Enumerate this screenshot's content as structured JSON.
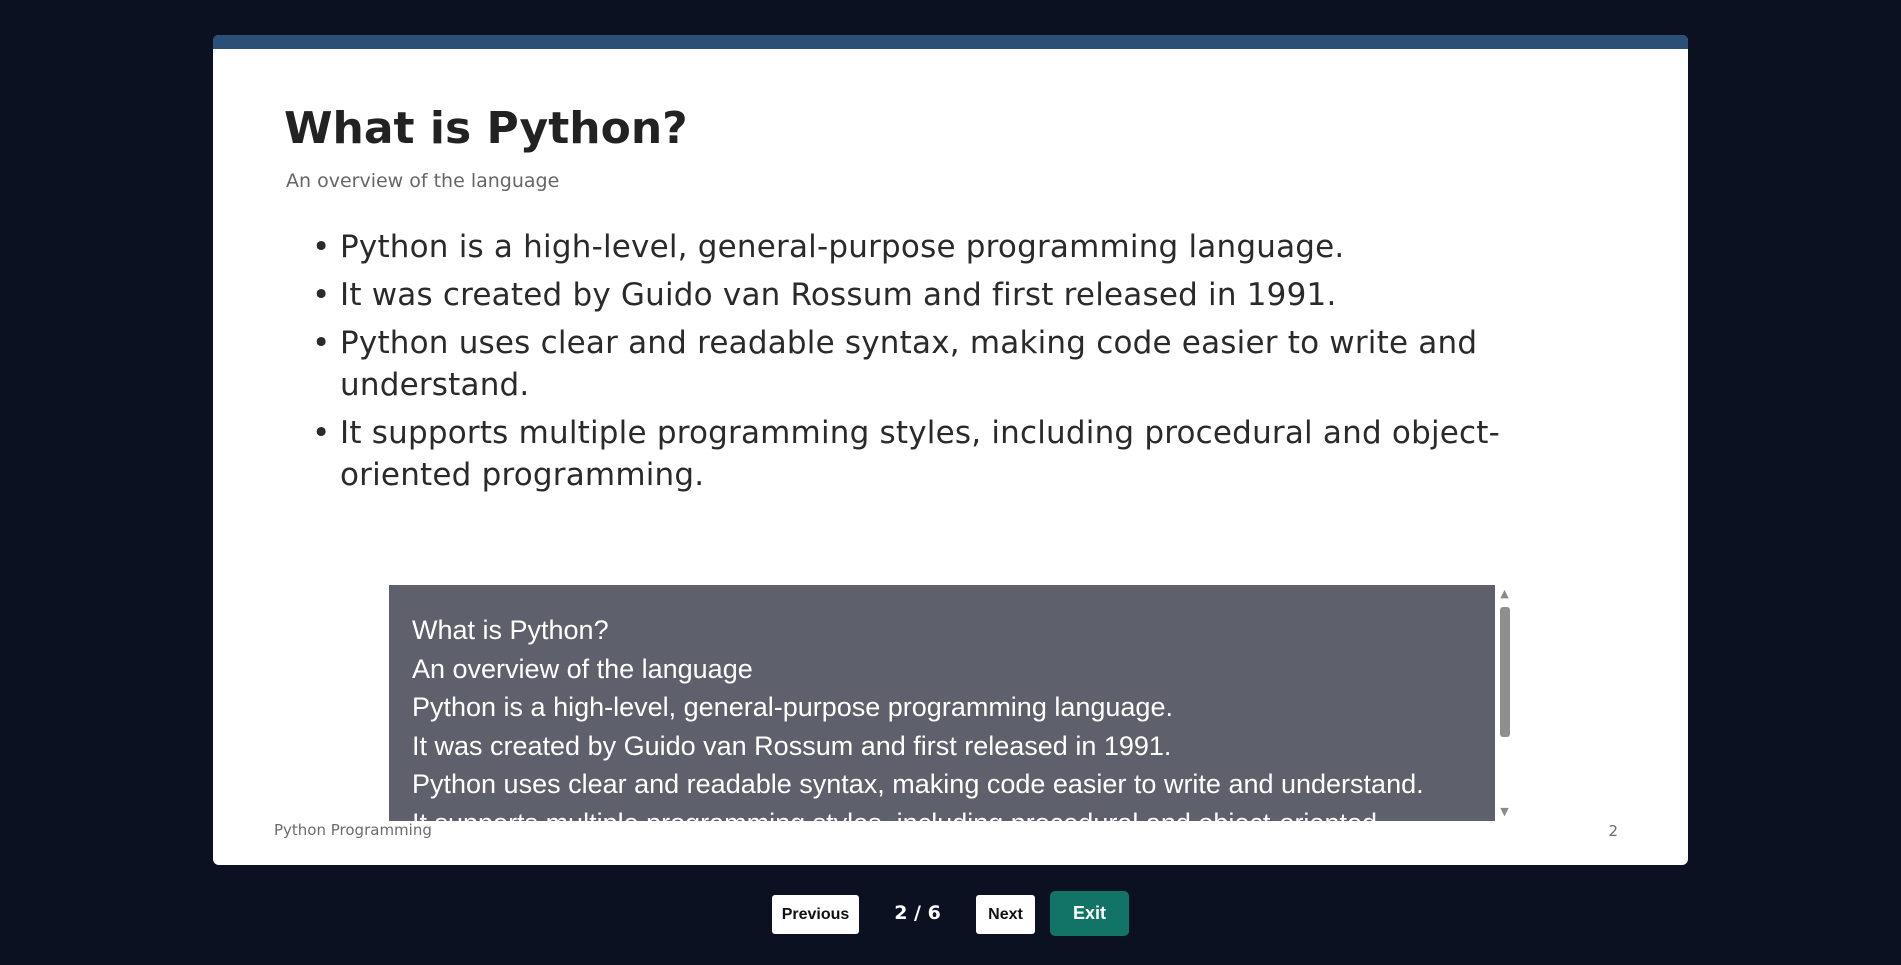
{
  "slide": {
    "title": "What is Python?",
    "subtitle": "An overview of the language",
    "bullets": [
      "Python is a high-level, general-purpose programming language.",
      "It was created by Guido van Rossum and first released in 1991.",
      "Python uses clear and readable syntax, making code easier to write and understand.",
      "It supports multiple programming styles, including procedural and object-oriented programming."
    ],
    "footer_left": "Python Programming",
    "footer_right": "2"
  },
  "captions": {
    "lines": [
      "What is Python?",
      "An overview of the language",
      "Python is a high-level, general-purpose programming language.",
      "It was created by Guido van Rossum and first released in 1991.",
      "Python uses clear and readable syntax, making code easier to write and understand.",
      "It supports multiple programming styles, including procedural and object-oriented"
    ],
    "scroll_up_icon": "▲",
    "scroll_down_icon": "▼"
  },
  "controls": {
    "previous_label": "Previous",
    "page_indicator": "2 / 6",
    "next_label": "Next",
    "exit_label": "Exit"
  },
  "colors": {
    "background": "#0b1120",
    "slide_accent_bar": "#2b5077",
    "caption_background": "#5e616b",
    "exit_button": "#127466"
  }
}
